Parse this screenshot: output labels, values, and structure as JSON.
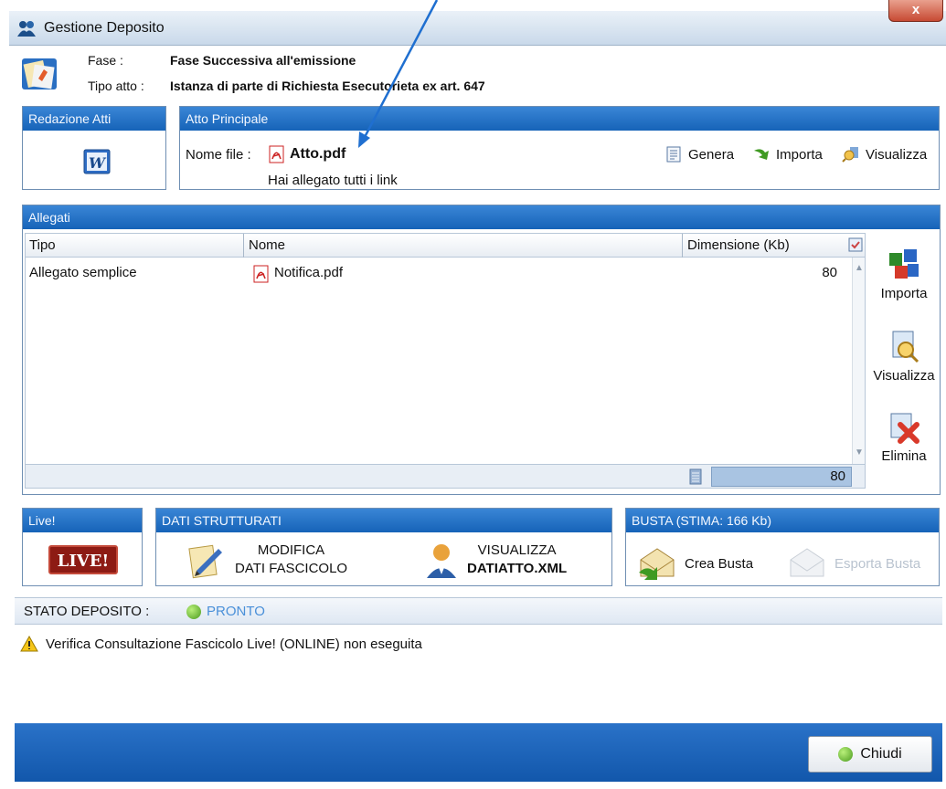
{
  "window": {
    "title": "Gestione Deposito",
    "close_label": "x"
  },
  "header": {
    "fase_label": "Fase :",
    "fase_value": "Fase Successiva all'emissione",
    "tipo_label": "Tipo atto :",
    "tipo_value": "Istanza di parte di Richiesta Esecutorieta ex art. 647"
  },
  "redazione": {
    "title": "Redazione Atti"
  },
  "atto": {
    "title": "Atto Principale",
    "nome_label": "Nome file :",
    "file_name": "Atto.pdf",
    "message": "Hai allegato tutti i link",
    "actions": [
      "Genera",
      "Importa",
      "Visualizza"
    ]
  },
  "allegati": {
    "title": "Allegati",
    "columns": [
      "Tipo",
      "Nome",
      "Dimensione (Kb)"
    ],
    "rows": [
      {
        "tipo": "Allegato semplice",
        "nome": "Notifica.pdf",
        "dimensione": "80"
      }
    ],
    "total": "80",
    "side_actions": [
      "Importa",
      "Visualizza",
      "Elimina"
    ]
  },
  "live": {
    "title": "Live!",
    "badge": "LIVE!"
  },
  "dati": {
    "title": "DATI STRUTTURATI",
    "modifica_line1": "MODIFICA",
    "modifica_line2": "DATI FASCICOLO",
    "visualizza_line1": "VISUALIZZA",
    "visualizza_line2": "DATIATTO.XML"
  },
  "busta": {
    "title": "BUSTA (STIMA: 166 Kb)",
    "crea": "Crea Busta",
    "esporta": "Esporta Busta"
  },
  "stato": {
    "label": "STATO DEPOSITO :",
    "value": "PRONTO"
  },
  "log": {
    "message": "Verifica Consultazione Fascicolo Live! (ONLINE) non eseguita"
  },
  "footer": {
    "chiudi": "Chiudi"
  },
  "colors": {
    "panel_header": "#1663b8",
    "footer": "#1257ab",
    "status_ok": "#4a9a1e",
    "annotation": "#1f6fd0"
  }
}
